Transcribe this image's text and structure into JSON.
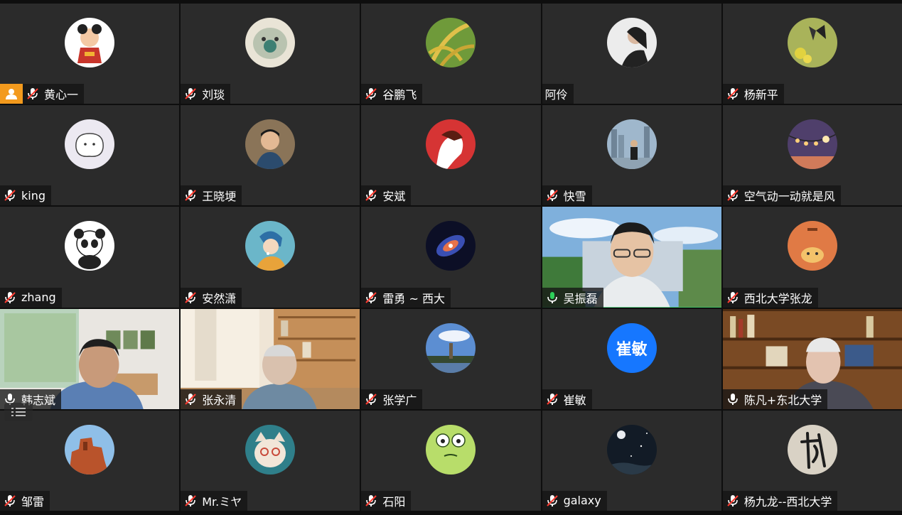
{
  "participants": [
    {
      "name": "黄心一",
      "mic": "muted",
      "avatar": "cartoon-girl",
      "host": true
    },
    {
      "name": "刘琰",
      "mic": "muted",
      "avatar": "cat-face"
    },
    {
      "name": "谷鹏飞",
      "mic": "muted",
      "avatar": "rice-plant"
    },
    {
      "name": "阿伶",
      "mic": "none",
      "avatar": "woman-photo"
    },
    {
      "name": "杨新平",
      "mic": "muted",
      "avatar": "butterfly"
    },
    {
      "name": "king",
      "mic": "muted",
      "avatar": "white-blob"
    },
    {
      "name": "王晓埂",
      "mic": "muted",
      "avatar": "man-photo"
    },
    {
      "name": "安斌",
      "mic": "muted",
      "avatar": "red-portrait"
    },
    {
      "name": "快雪",
      "mic": "muted",
      "avatar": "city-man"
    },
    {
      "name": "空气动一动就是风",
      "mic": "muted",
      "avatar": "string-lights"
    },
    {
      "name": "zhang",
      "mic": "muted",
      "avatar": "panda"
    },
    {
      "name": "安然潇",
      "mic": "muted",
      "avatar": "pearl-earring"
    },
    {
      "name": "雷勇 ~ 西大",
      "mic": "muted",
      "avatar": "galaxy-spiral"
    },
    {
      "name": "吴振磊",
      "mic": "active",
      "video": "man-cartoon-bg",
      "speaking": true
    },
    {
      "name": "西北大学张龙",
      "mic": "muted",
      "avatar": "tiger-cartoon"
    },
    {
      "name": "韩志斌",
      "mic": "on",
      "video": "man-room"
    },
    {
      "name": "张永清",
      "mic": "muted",
      "video": "man-library"
    },
    {
      "name": "张学广",
      "mic": "muted",
      "avatar": "pagoda-sky"
    },
    {
      "name": "崔敏",
      "mic": "muted",
      "avatar_text": "崔敏"
    },
    {
      "name": "陈凡+东北大学",
      "mic": "on",
      "video": "man-bookshelf"
    },
    {
      "name": "邹雷",
      "mic": "muted",
      "avatar": "red-rock"
    },
    {
      "name": "Mr.ミヤ",
      "mic": "muted",
      "avatar": "cat-glasses"
    },
    {
      "name": "石阳",
      "mic": "muted",
      "avatar": "frog"
    },
    {
      "name": "galaxy",
      "mic": "muted",
      "avatar": "night-sky"
    },
    {
      "name": "杨九龙--西北大学",
      "mic": "muted",
      "avatar": "calligraphy"
    }
  ],
  "colors": {
    "tile_bg": "#2b2b2b",
    "active_border": "#2dd05a",
    "host_badge": "#f39a1d",
    "text_avatar": "#1677ff"
  }
}
